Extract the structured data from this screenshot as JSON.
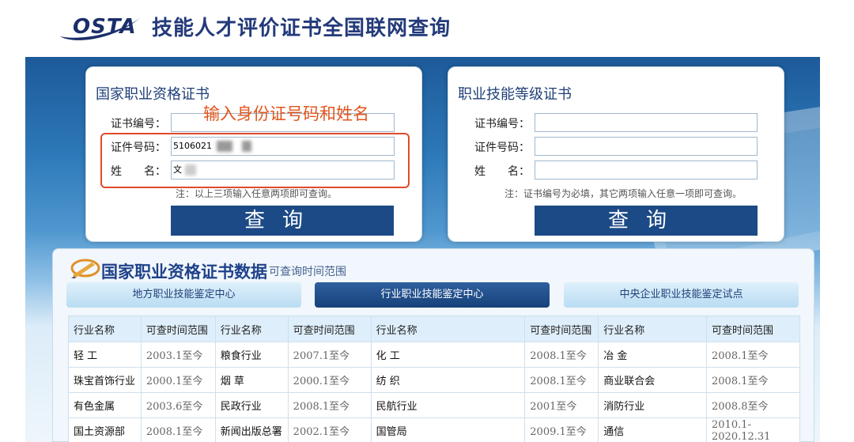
{
  "header": {
    "logo_text": "OSTA",
    "title": "技能人才评价证书全国联网查询"
  },
  "panel_left": {
    "title": "国家职业资格证书",
    "fields": [
      {
        "label": "证书编号：",
        "value": ""
      },
      {
        "label": "证件号码：",
        "value": "5106021"
      },
      {
        "label": "姓　　名：",
        "value": "文"
      }
    ],
    "note": "注：以上三项输入任意两项即可查询。",
    "button": "查询"
  },
  "annotation": "输入身份证号码和姓名",
  "panel_right": {
    "title": "职业技能等级证书",
    "fields": [
      {
        "label": "证书编号：",
        "value": ""
      },
      {
        "label": "证件号码：",
        "value": ""
      },
      {
        "label": "姓　　名：",
        "value": ""
      }
    ],
    "note": "注：证书编号为必填，其它两项输入任意一项即可查询。",
    "button": "查询"
  },
  "data_section": {
    "title": "国家职业资格证书数据",
    "subtitle": "可查询时间范围",
    "tabs": [
      "地方职业技能鉴定中心",
      "行业职业技能鉴定中心",
      "中央企业职业技能鉴定试点"
    ],
    "active_tab": 1,
    "headers": [
      "行业名称",
      "可查时间范围",
      "行业名称",
      "可查时间范围",
      "行业名称",
      "可查时间范围",
      "行业名称",
      "可查时间范围"
    ],
    "rows": [
      [
        "轻 工",
        "2003.1至今",
        "粮食行业",
        "2007.1至今",
        "化 工",
        "2008.1至今",
        "冶 金",
        "2008.1至今"
      ],
      [
        "珠宝首饰行业",
        "2000.1至今",
        "烟 草",
        "2000.1至今",
        "纺 织",
        "2008.1至今",
        "商业联合会",
        "2008.1至今"
      ],
      [
        "有色金属",
        "2003.6至今",
        "民政行业",
        "2008.1至今",
        "民航行业",
        "2001至今",
        "消防行业",
        "2008.8至今"
      ],
      [
        "国土资源部",
        "2008.1至今",
        "新闻出版总署",
        "2002.1至今",
        "国管局",
        "2009.1至今",
        "通信",
        "2010.1-2020.12.31"
      ]
    ]
  },
  "colors": {
    "brand_blue": "#1c4a86",
    "annotation_red": "#e2551c"
  }
}
